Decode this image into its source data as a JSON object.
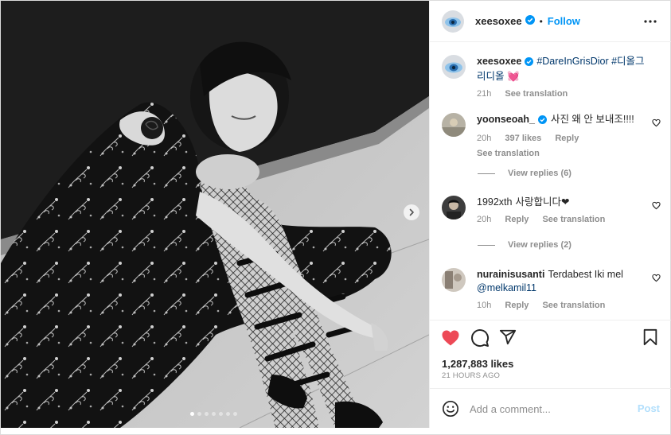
{
  "post": {
    "author": "xeesoxee",
    "follow_label": "Follow",
    "separator": "•",
    "media": {
      "slide_count": 7,
      "active_slide": 1
    },
    "caption": {
      "user": "xeesoxee",
      "text": "#DareInGrisDior #디올그리디올 💓",
      "time": "21h",
      "see_translation": "See translation"
    },
    "comments": [
      {
        "user": "yoonseoah_",
        "verified": true,
        "text": "사진 왜 안 보내조!!!!",
        "time": "20h",
        "likes": "397 likes",
        "reply": "Reply",
        "see_translation": "See translation",
        "view_replies": "View replies (6)"
      },
      {
        "user": "1992xth",
        "verified": false,
        "text": "사랑합니다❤",
        "time": "20h",
        "reply": "Reply",
        "see_translation": "See translation",
        "view_replies": "View replies (2)"
      },
      {
        "user": "nurainisusanti",
        "verified": false,
        "text": "Terdabest Iki mel",
        "mention": "@melkamil11",
        "time": "10h",
        "reply": "Reply",
        "see_translation": "See translation"
      }
    ],
    "likes": "1,287,883 likes",
    "time_ago": "21 HOURS AGO",
    "add_comment_placeholder": "Add a comment...",
    "post_button": "Post",
    "colors": {
      "accent": "#0095f6",
      "like": "#ed4956",
      "post_disabled": "#b2dffc",
      "muted": "#8e8e8e"
    },
    "icons": [
      "verified-icon",
      "more-icon",
      "heart-icon",
      "comment-icon",
      "share-icon",
      "bookmark-icon",
      "emoji-icon",
      "chevron-right-icon"
    ]
  }
}
